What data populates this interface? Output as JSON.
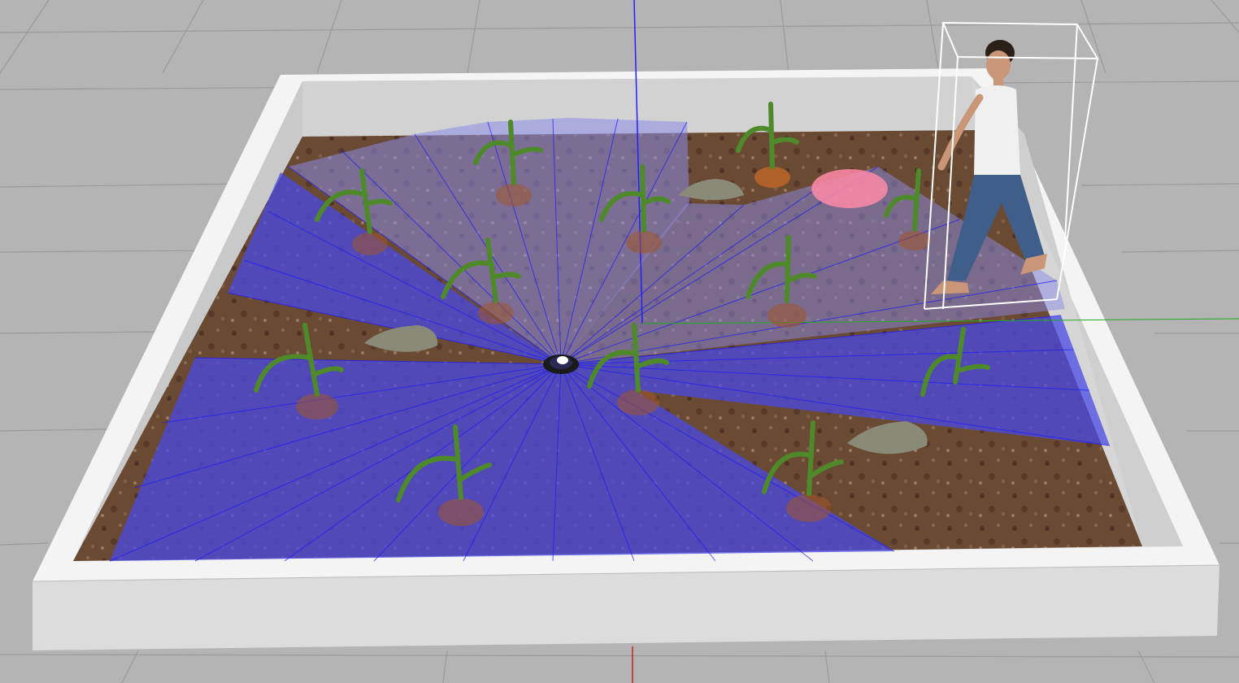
{
  "scene": {
    "colors": {
      "background": "#b4b4b4",
      "grid_line": "#9a9a9a",
      "wall_top": "#f4f4f4",
      "wall_inner": "#d6d6d6",
      "wall_front": "#dcdcdc",
      "soil": "#6b4a33",
      "lidar_fill": "#4a4ae6",
      "lidar_ray": "#1a1aff",
      "z_axis": "#2020ff",
      "x_axis": "#cc2222",
      "y_axis": "#22aa22",
      "plant_leaf": "#4e8a2a",
      "pot": "#a0562a",
      "rock": "#8a8a78",
      "goal_marker": "#ff8aa8",
      "selection_box": "#ffffff",
      "person_shirt": "#f0f0f0",
      "person_jeans": "#3f5f8a",
      "person_skin": "#c99677"
    },
    "objects": {
      "lidar_sensor": "lidar-robot",
      "plants": [
        "plant",
        "plant",
        "plant",
        "plant",
        "plant",
        "plant",
        "plant",
        "plant",
        "plant",
        "plant",
        "plant",
        "plant",
        "plant"
      ],
      "rocks": [
        "rock",
        "rock",
        "rock"
      ],
      "person": "walking-person",
      "goal": "goal-marker"
    }
  }
}
